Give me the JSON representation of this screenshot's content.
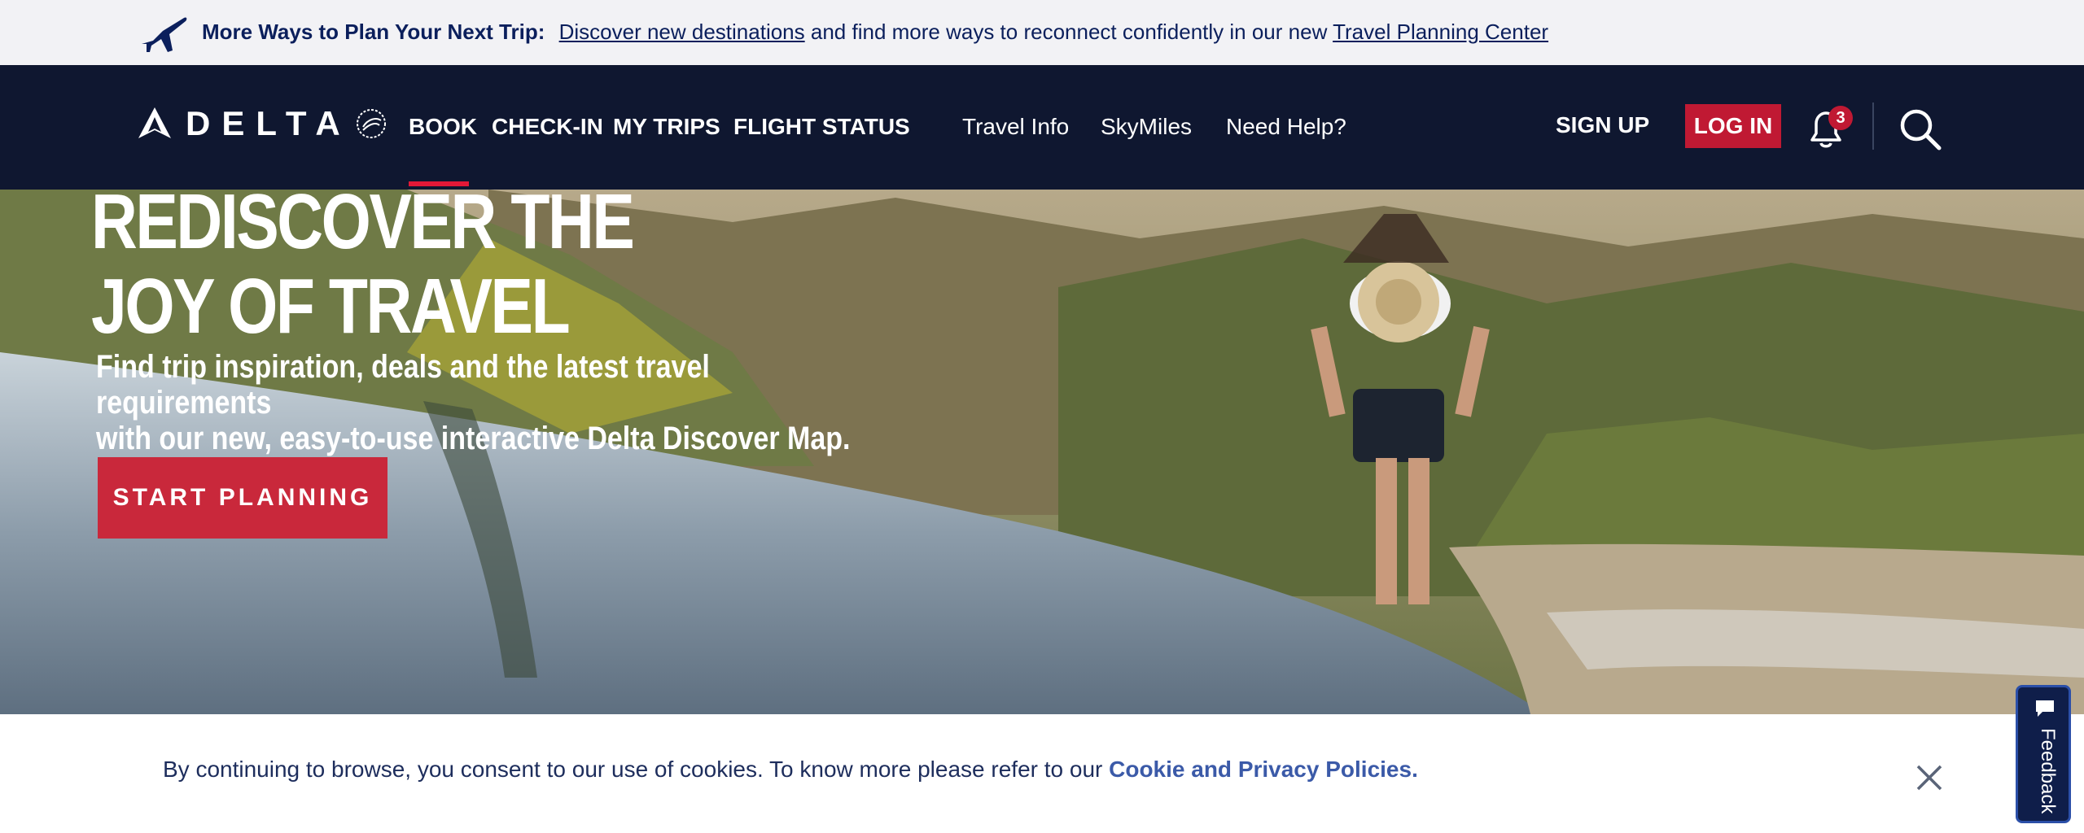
{
  "promo": {
    "lead": "More Ways to Plan Your Next Trip:",
    "link1": "Discover new destinations",
    "middle": " and find more ways to reconnect confidently in our new ",
    "link2": "Travel Planning Center"
  },
  "nav": {
    "brand": "DELTA",
    "primary": [
      "BOOK",
      "CHECK-IN",
      "MY TRIPS",
      "FLIGHT STATUS"
    ],
    "secondary": [
      "Travel Info",
      "SkyMiles",
      "Need Help?"
    ],
    "signup": "SIGN UP",
    "login": "LOG IN",
    "notification_count": "3"
  },
  "hero": {
    "headline_line1": "REDISCOVER THE",
    "headline_line2": "JOY OF TRAVEL",
    "sub_line1": "Find trip inspiration, deals and the latest travel requirements",
    "sub_line2": "with our new, easy-to-use interactive Delta Discover Map.",
    "cta": "START PLANNING"
  },
  "cookie": {
    "message": "By continuing to browse, you consent to our use of cookies. To know more please refer to our ",
    "link": "Cookie and Privacy Policies."
  },
  "feedback": {
    "label": "Feedback"
  },
  "colors": {
    "navy": "#0f1730",
    "red": "#c01933",
    "accent": "#e31837",
    "link": "#3b5aa8"
  },
  "icons": [
    "plane-icon",
    "delta-widget-logo",
    "skyteam-seal-icon",
    "bell-icon",
    "search-icon",
    "close-icon",
    "feedback-icon"
  ]
}
